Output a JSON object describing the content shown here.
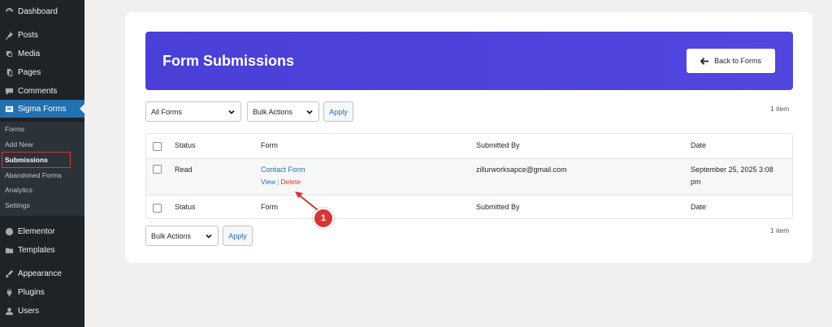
{
  "sidebar": {
    "items": [
      {
        "label": "Dashboard",
        "icon": "dashboard-icon"
      },
      {
        "label": "Posts",
        "icon": "pin-icon"
      },
      {
        "label": "Media",
        "icon": "media-icon"
      },
      {
        "label": "Pages",
        "icon": "pages-icon"
      },
      {
        "label": "Comments",
        "icon": "comment-icon"
      },
      {
        "label": "Sigma Forms",
        "icon": "forms-icon"
      },
      {
        "label": "Elementor",
        "icon": "elementor-icon"
      },
      {
        "label": "Templates",
        "icon": "folder-icon"
      },
      {
        "label": "Appearance",
        "icon": "brush-icon"
      },
      {
        "label": "Plugins",
        "icon": "plugin-icon"
      },
      {
        "label": "Users",
        "icon": "user-icon"
      }
    ],
    "submenu": [
      "Forms",
      "Add New",
      "Submissions",
      "Abandoned Forms",
      "Analytics",
      "Settings"
    ]
  },
  "banner": {
    "title": "Form Submissions",
    "back_label": "Back to Forms"
  },
  "filters": {
    "form_select": "All Forms",
    "bulk_select": "Bulk Actions",
    "apply_label": "Apply",
    "count": "1 item"
  },
  "table": {
    "headers": [
      "Status",
      "Form",
      "Submitted By",
      "Date"
    ],
    "rows": [
      {
        "status": "Read",
        "form": "Contact Form",
        "submitted_by": "zillurworksapce@gmail.com",
        "date_line1": "September 25, 2025 3:08",
        "date_line2": "pm",
        "view_label": "View",
        "delete_label": "Delete"
      }
    ]
  },
  "footer": {
    "bulk_select": "Bulk Actions",
    "apply_label": "Apply",
    "count": "1 item"
  },
  "annotation": {
    "number": "1"
  },
  "colors": {
    "banner": "#4a3fd6",
    "accent": "#2271b1",
    "danger": "#d63638"
  }
}
